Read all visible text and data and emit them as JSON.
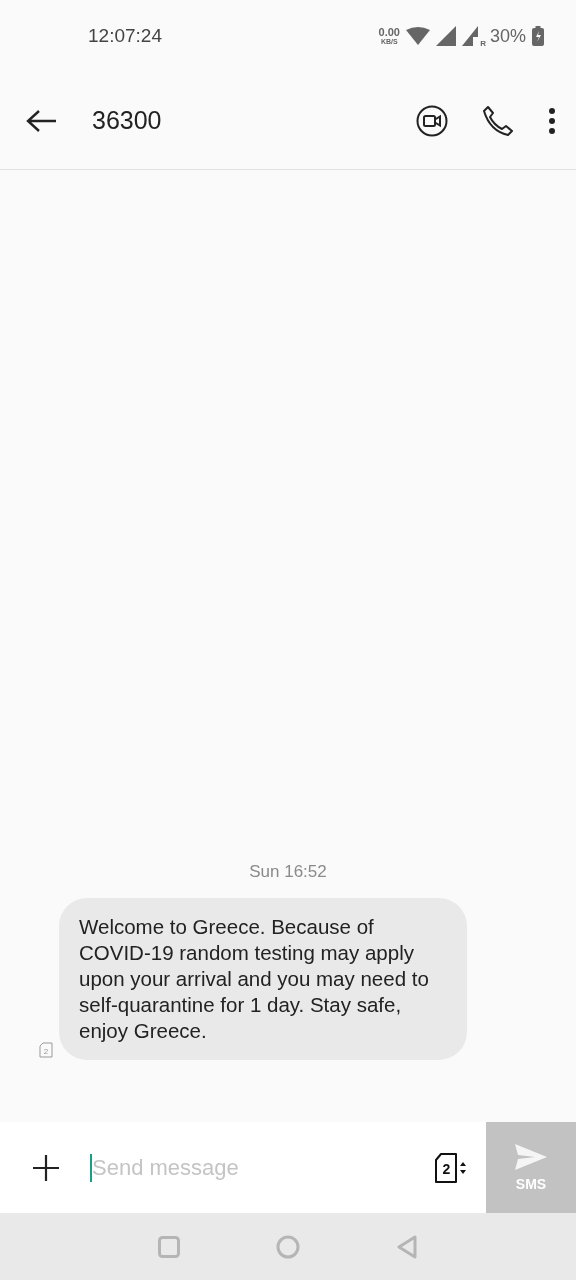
{
  "status_bar": {
    "time": "12:07:24",
    "net_speed": "0.00",
    "net_unit": "KB/S",
    "roaming": "R",
    "battery": "30%"
  },
  "header": {
    "title": "36300"
  },
  "messages": [
    {
      "timestamp": "Sun 16:52",
      "text": "Welcome to Greece. Because of COVID-19 random testing may apply upon your arrival and you may need to self-quarantine for 1 day. Stay safe, enjoy Greece.",
      "sim": "2"
    }
  ],
  "composer": {
    "placeholder": "Send message",
    "sim": "2",
    "send_label": "SMS"
  }
}
